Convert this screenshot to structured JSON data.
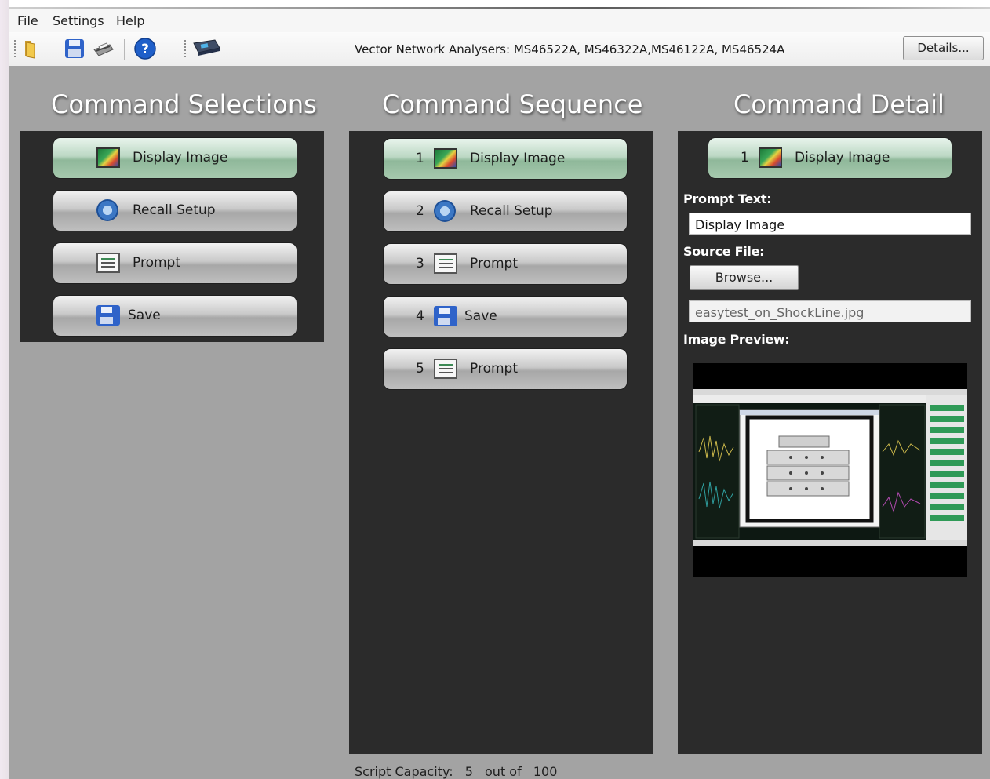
{
  "menu": [
    "File",
    "Settings",
    "Help"
  ],
  "toolbar": {
    "icons": [
      "folder-icon",
      "save-icon",
      "print-icon",
      "help-icon",
      "instrument-icon"
    ],
    "vna_text": "Vector Network Analysers: MS46522A, MS46322A,MS46122A, MS46524A",
    "details_label": "Details..."
  },
  "headings": {
    "selections": "Command Selections",
    "sequence": "Command Sequence",
    "detail": "Command Detail"
  },
  "selections": [
    {
      "label": "Display Image",
      "icon": "display-image-icon",
      "state": "selected"
    },
    {
      "label": "Recall Setup",
      "icon": "gear-icon",
      "state": "normal"
    },
    {
      "label": "Prompt",
      "icon": "prompt-icon",
      "state": "normal"
    },
    {
      "label": "Save",
      "icon": "save-icon",
      "state": "normal"
    }
  ],
  "sequence": [
    {
      "num": "1",
      "label": "Display Image",
      "icon": "display-image-icon",
      "state": "selected"
    },
    {
      "num": "2",
      "label": "Recall Setup",
      "icon": "gear-icon",
      "state": "normal"
    },
    {
      "num": "3",
      "label": "Prompt",
      "icon": "prompt-icon",
      "state": "normal"
    },
    {
      "num": "4",
      "label": "Save",
      "icon": "save-icon",
      "state": "normal"
    },
    {
      "num": "5",
      "label": "Prompt",
      "icon": "prompt-icon",
      "state": "normal"
    }
  ],
  "detail": {
    "num": "1",
    "title": "Display Image",
    "prompt_text_label": "Prompt Text:",
    "prompt_text_value": "Display Image",
    "source_file_label": "Source File:",
    "browse_label": "Browse...",
    "source_file_value": "easytest_on_ShockLine.jpg",
    "image_preview_label": "Image Preview:"
  },
  "status": {
    "capacity_label": "Script Capacity:",
    "used": "5",
    "out_of": "out of",
    "max": "100"
  },
  "colors": {
    "workspace": "#a3a3a3",
    "panel": "#2b2b2b",
    "selected_button": "#a6c9ae",
    "normal_button": "#bfbfbf"
  }
}
